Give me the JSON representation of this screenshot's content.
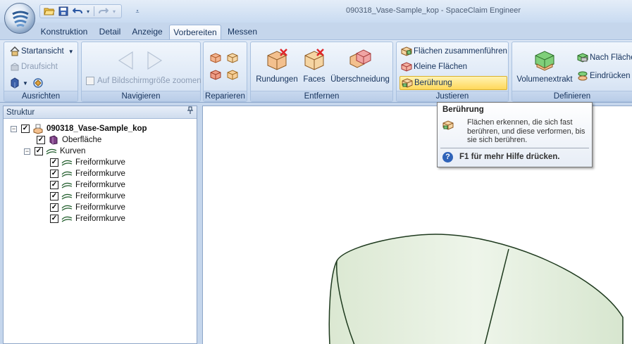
{
  "window": {
    "title": "090318_Vase-Sample_kop - SpaceClaim Engineer"
  },
  "quick_access": [
    {
      "name": "open-icon"
    },
    {
      "name": "save-icon"
    },
    {
      "name": "undo-icon"
    },
    {
      "name": "redo-icon"
    },
    {
      "name": "customize-icon"
    }
  ],
  "tabs": [
    {
      "label": "Konstruktion",
      "active": false
    },
    {
      "label": "Detail",
      "active": false
    },
    {
      "label": "Anzeige",
      "active": false
    },
    {
      "label": "Vorbereiten",
      "active": true
    },
    {
      "label": "Messen",
      "active": false
    }
  ],
  "ribbon": {
    "ausrichten": {
      "label": "Ausrichten",
      "startansicht": "Startansicht",
      "draufsicht": "Draufsicht"
    },
    "navigieren": {
      "label": "Navigieren",
      "zoom": "Auf Bildschirmgröße zoomen"
    },
    "reparieren": {
      "label": "Reparieren"
    },
    "entfernen": {
      "label": "Entfernen",
      "rundungen": "Rundungen",
      "faces": "Faces",
      "ueberschneidung": "Überschneidung"
    },
    "justieren": {
      "label": "Justieren",
      "flaechen_zusammenfuehren": "Flächen zusammenführen",
      "kleine_flaechen": "Kleine Flächen",
      "beruehrung": "Berührung"
    },
    "definieren": {
      "label": "Definieren",
      "volumenextrakt": "Volumenextrakt",
      "nach_flaechen": "Nach Fläche",
      "eindruecken": "Eindrücken"
    }
  },
  "structure": {
    "title": "Struktur",
    "items": [
      {
        "label": "090318_Vase-Sample_kop",
        "bold": true,
        "icon": "assembly-icon"
      },
      {
        "label": "Oberfläche",
        "icon": "surface-icon"
      },
      {
        "label": "Kurven",
        "icon": "curves-group-icon"
      },
      {
        "label": "Freiformkurve",
        "icon": "curve-icon"
      },
      {
        "label": "Freiformkurve",
        "icon": "curve-icon"
      },
      {
        "label": "Freiformkurve",
        "icon": "curve-icon"
      },
      {
        "label": "Freiformkurve",
        "icon": "curve-icon"
      },
      {
        "label": "Freiformkurve",
        "icon": "curve-icon"
      },
      {
        "label": "Freiformkurve",
        "icon": "curve-icon"
      }
    ]
  },
  "tooltip": {
    "title": "Berührung",
    "body": "Flächen erkennen, die sich fast berühren, und diese verformen, bis sie sich berühren.",
    "help": "F1 für mehr Hilfe drücken."
  },
  "colors": {
    "model_fill": "#e3eedd",
    "model_edge": "#1e3a1e",
    "highlight": "#ffd85a"
  }
}
